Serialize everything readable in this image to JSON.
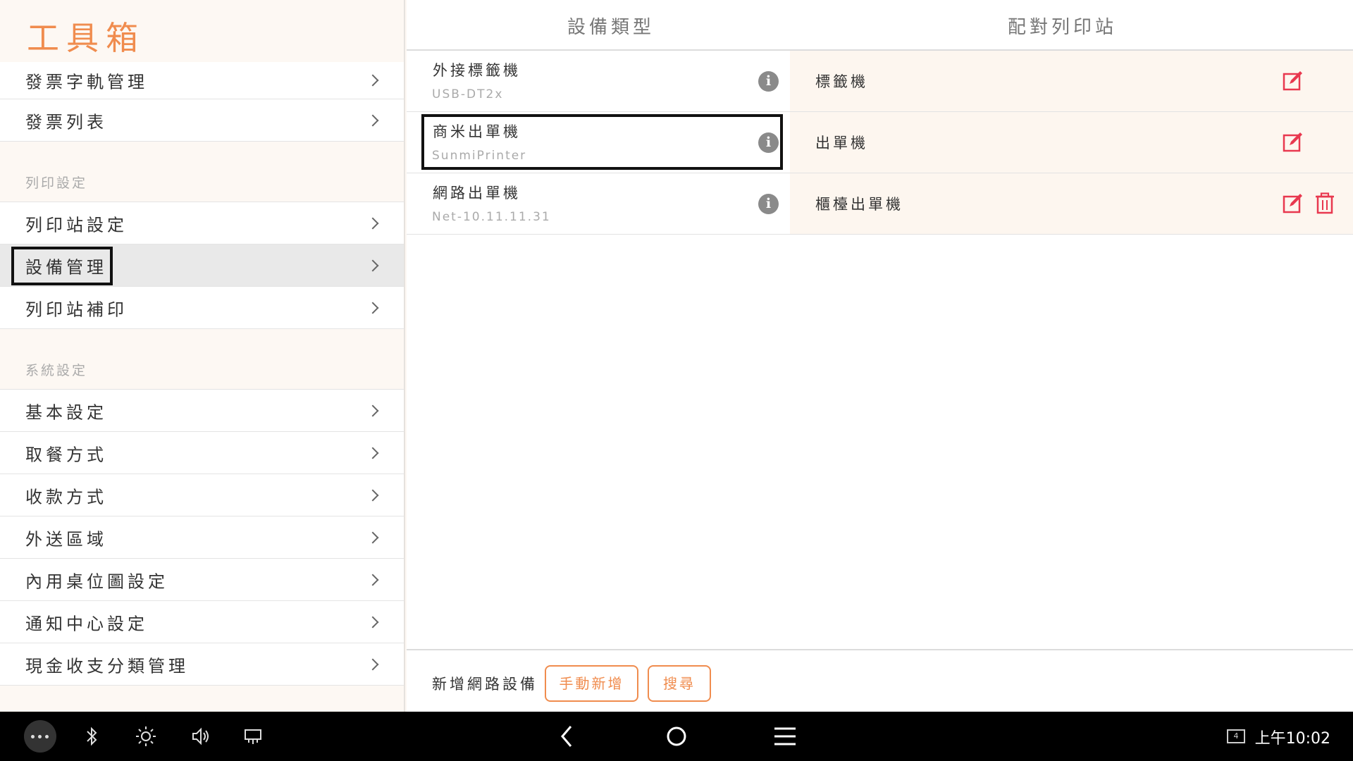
{
  "sidebar": {
    "title": "工具箱",
    "groups": [
      {
        "header": "",
        "items": [
          {
            "label": "發票字軌管理"
          },
          {
            "label": "發票列表"
          }
        ]
      },
      {
        "header": "列印設定",
        "items": [
          {
            "label": "列印站設定"
          },
          {
            "label": "設備管理",
            "active": true
          },
          {
            "label": "列印站補印"
          }
        ]
      },
      {
        "header": "系統設定",
        "items": [
          {
            "label": "基本設定"
          },
          {
            "label": "取餐方式"
          },
          {
            "label": "收款方式"
          },
          {
            "label": "外送區域"
          },
          {
            "label": "內用桌位圖設定"
          },
          {
            "label": "通知中心設定"
          },
          {
            "label": "現金收支分類管理"
          }
        ]
      }
    ]
  },
  "table": {
    "headers": {
      "device_type": "設備類型",
      "station": "配對列印站"
    },
    "rows": [
      {
        "name": "外接標籤機",
        "subtitle": "USB-DT2x",
        "station": "標籤機",
        "deletable": false
      },
      {
        "name": "商米出單機",
        "subtitle": "SunmiPrinter",
        "station": "出單機",
        "deletable": false,
        "selected": true
      },
      {
        "name": "網路出單機",
        "subtitle": "Net-10.11.11.31",
        "station": "櫃檯出單機",
        "deletable": true
      }
    ]
  },
  "footer": {
    "label": "新增網路設備",
    "manual_button": "手動新增",
    "search_button": "搜尋"
  },
  "navbar": {
    "icons": [
      "more-icon",
      "bluetooth-icon",
      "brightness-icon",
      "volume-icon",
      "keyboard-icon",
      "back-icon",
      "home-icon",
      "menu-icon",
      "screen-icon"
    ],
    "badge": "4",
    "time": "上午10:02"
  },
  "colors": {
    "accent": "#f08c4e",
    "edit": "#e8384f",
    "station_bg": "#fdf6ef"
  }
}
